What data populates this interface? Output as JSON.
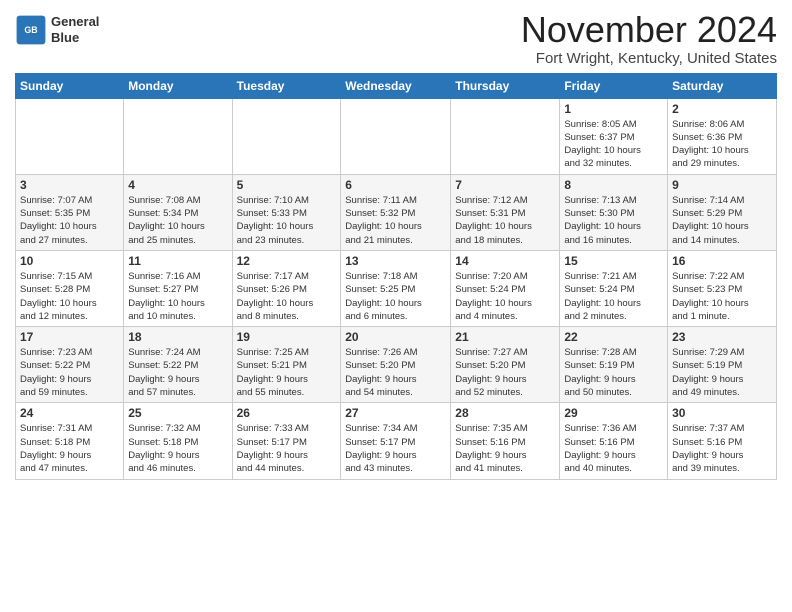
{
  "header": {
    "logo_line1": "General",
    "logo_line2": "Blue",
    "month": "November 2024",
    "location": "Fort Wright, Kentucky, United States"
  },
  "weekdays": [
    "Sunday",
    "Monday",
    "Tuesday",
    "Wednesday",
    "Thursday",
    "Friday",
    "Saturday"
  ],
  "weeks": [
    [
      {
        "day": "",
        "info": ""
      },
      {
        "day": "",
        "info": ""
      },
      {
        "day": "",
        "info": ""
      },
      {
        "day": "",
        "info": ""
      },
      {
        "day": "",
        "info": ""
      },
      {
        "day": "1",
        "info": "Sunrise: 8:05 AM\nSunset: 6:37 PM\nDaylight: 10 hours\nand 32 minutes."
      },
      {
        "day": "2",
        "info": "Sunrise: 8:06 AM\nSunset: 6:36 PM\nDaylight: 10 hours\nand 29 minutes."
      }
    ],
    [
      {
        "day": "3",
        "info": "Sunrise: 7:07 AM\nSunset: 5:35 PM\nDaylight: 10 hours\nand 27 minutes."
      },
      {
        "day": "4",
        "info": "Sunrise: 7:08 AM\nSunset: 5:34 PM\nDaylight: 10 hours\nand 25 minutes."
      },
      {
        "day": "5",
        "info": "Sunrise: 7:10 AM\nSunset: 5:33 PM\nDaylight: 10 hours\nand 23 minutes."
      },
      {
        "day": "6",
        "info": "Sunrise: 7:11 AM\nSunset: 5:32 PM\nDaylight: 10 hours\nand 21 minutes."
      },
      {
        "day": "7",
        "info": "Sunrise: 7:12 AM\nSunset: 5:31 PM\nDaylight: 10 hours\nand 18 minutes."
      },
      {
        "day": "8",
        "info": "Sunrise: 7:13 AM\nSunset: 5:30 PM\nDaylight: 10 hours\nand 16 minutes."
      },
      {
        "day": "9",
        "info": "Sunrise: 7:14 AM\nSunset: 5:29 PM\nDaylight: 10 hours\nand 14 minutes."
      }
    ],
    [
      {
        "day": "10",
        "info": "Sunrise: 7:15 AM\nSunset: 5:28 PM\nDaylight: 10 hours\nand 12 minutes."
      },
      {
        "day": "11",
        "info": "Sunrise: 7:16 AM\nSunset: 5:27 PM\nDaylight: 10 hours\nand 10 minutes."
      },
      {
        "day": "12",
        "info": "Sunrise: 7:17 AM\nSunset: 5:26 PM\nDaylight: 10 hours\nand 8 minutes."
      },
      {
        "day": "13",
        "info": "Sunrise: 7:18 AM\nSunset: 5:25 PM\nDaylight: 10 hours\nand 6 minutes."
      },
      {
        "day": "14",
        "info": "Sunrise: 7:20 AM\nSunset: 5:24 PM\nDaylight: 10 hours\nand 4 minutes."
      },
      {
        "day": "15",
        "info": "Sunrise: 7:21 AM\nSunset: 5:24 PM\nDaylight: 10 hours\nand 2 minutes."
      },
      {
        "day": "16",
        "info": "Sunrise: 7:22 AM\nSunset: 5:23 PM\nDaylight: 10 hours\nand 1 minute."
      }
    ],
    [
      {
        "day": "17",
        "info": "Sunrise: 7:23 AM\nSunset: 5:22 PM\nDaylight: 9 hours\nand 59 minutes."
      },
      {
        "day": "18",
        "info": "Sunrise: 7:24 AM\nSunset: 5:22 PM\nDaylight: 9 hours\nand 57 minutes."
      },
      {
        "day": "19",
        "info": "Sunrise: 7:25 AM\nSunset: 5:21 PM\nDaylight: 9 hours\nand 55 minutes."
      },
      {
        "day": "20",
        "info": "Sunrise: 7:26 AM\nSunset: 5:20 PM\nDaylight: 9 hours\nand 54 minutes."
      },
      {
        "day": "21",
        "info": "Sunrise: 7:27 AM\nSunset: 5:20 PM\nDaylight: 9 hours\nand 52 minutes."
      },
      {
        "day": "22",
        "info": "Sunrise: 7:28 AM\nSunset: 5:19 PM\nDaylight: 9 hours\nand 50 minutes."
      },
      {
        "day": "23",
        "info": "Sunrise: 7:29 AM\nSunset: 5:19 PM\nDaylight: 9 hours\nand 49 minutes."
      }
    ],
    [
      {
        "day": "24",
        "info": "Sunrise: 7:31 AM\nSunset: 5:18 PM\nDaylight: 9 hours\nand 47 minutes."
      },
      {
        "day": "25",
        "info": "Sunrise: 7:32 AM\nSunset: 5:18 PM\nDaylight: 9 hours\nand 46 minutes."
      },
      {
        "day": "26",
        "info": "Sunrise: 7:33 AM\nSunset: 5:17 PM\nDaylight: 9 hours\nand 44 minutes."
      },
      {
        "day": "27",
        "info": "Sunrise: 7:34 AM\nSunset: 5:17 PM\nDaylight: 9 hours\nand 43 minutes."
      },
      {
        "day": "28",
        "info": "Sunrise: 7:35 AM\nSunset: 5:16 PM\nDaylight: 9 hours\nand 41 minutes."
      },
      {
        "day": "29",
        "info": "Sunrise: 7:36 AM\nSunset: 5:16 PM\nDaylight: 9 hours\nand 40 minutes."
      },
      {
        "day": "30",
        "info": "Sunrise: 7:37 AM\nSunset: 5:16 PM\nDaylight: 9 hours\nand 39 minutes."
      }
    ]
  ]
}
